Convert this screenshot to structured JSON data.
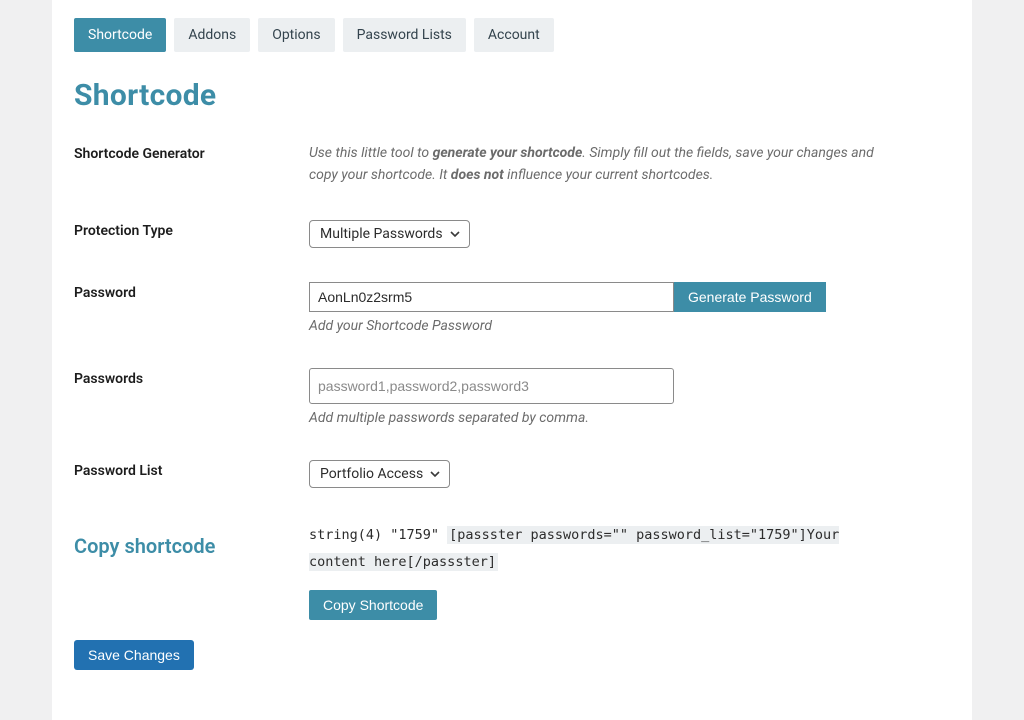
{
  "tabs": {
    "items": [
      {
        "label": "Shortcode",
        "active": true
      },
      {
        "label": "Addons",
        "active": false
      },
      {
        "label": "Options",
        "active": false
      },
      {
        "label": "Password Lists",
        "active": false
      },
      {
        "label": "Account",
        "active": false
      }
    ]
  },
  "page_title": "Shortcode",
  "generator": {
    "label": "Shortcode Generator",
    "help_pre": "Use this little tool to ",
    "help_strong1": "generate your shortcode",
    "help_mid": ". Simply fill out the fields, save your changes and copy your shortcode. It ",
    "help_strong2": "does not",
    "help_post": " influence your current shortcodes."
  },
  "protection_type": {
    "label": "Protection Type",
    "selected": "Multiple Passwords"
  },
  "password_single": {
    "label": "Password",
    "value": "AonLn0z2srm5",
    "generate_btn": "Generate Password",
    "desc": "Add your Shortcode Password"
  },
  "passwords_multi": {
    "label": "Passwords",
    "placeholder": "password1,password2,password3",
    "desc": "Add multiple passwords separated by comma."
  },
  "password_list": {
    "label": "Password List",
    "selected": "Portfolio Access"
  },
  "copy": {
    "label": "Copy shortcode",
    "prefix": "string(4) \"1759\" ",
    "code_open": "[passster passwords=\"\" password_list=\"1759\"]",
    "code_text": "Your content here",
    "code_close": "[/passster]",
    "btn": "Copy Shortcode"
  },
  "save_btn": "Save Changes"
}
